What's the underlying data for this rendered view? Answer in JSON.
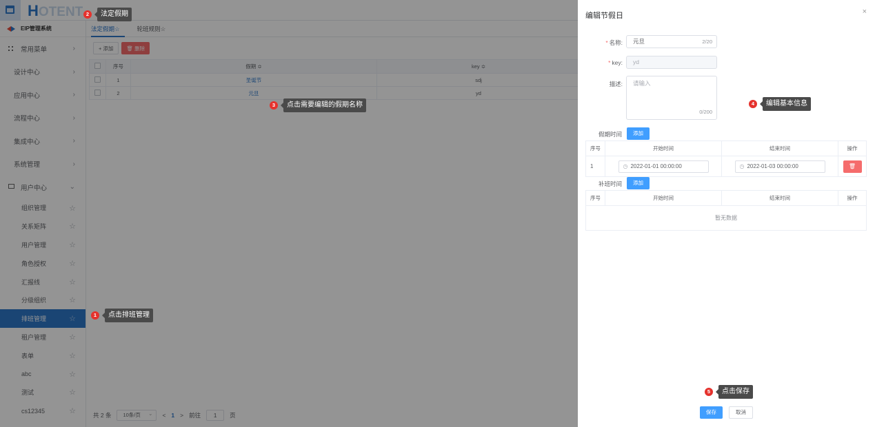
{
  "logo": {
    "first": "H",
    "rest": "OTENT"
  },
  "sidebar": {
    "system_title": "EIP管理系统",
    "favorites": "常用菜单",
    "groups": [
      "设计中心",
      "应用中心",
      "流程中心",
      "集成中心",
      "系统管理"
    ],
    "user_center": "用户中心",
    "sub_items": [
      "组织管理",
      "关系矩阵",
      "用户管理",
      "角色授权",
      "汇报线",
      "分级组织",
      "排班管理",
      "租户管理",
      "表单",
      "abc",
      "测试",
      "cs12345"
    ],
    "active_sub_item": "排班管理"
  },
  "main": {
    "tabs": [
      "法定假期☆",
      "轮班规则☆"
    ],
    "add_label": "+ 添加",
    "delete_label": "🗑 删除",
    "columns": [
      "序号",
      "假期 ≎",
      "key ≎"
    ],
    "rows": [
      {
        "index": "1",
        "name": "圣诞节",
        "key": "sdj"
      },
      {
        "index": "2",
        "name": "元旦",
        "key": "yd"
      }
    ],
    "pager": {
      "total": "共 2 条",
      "page_size": "10条/页",
      "prev": "<",
      "current": "1",
      "next": ">",
      "goto_prefix": "前往",
      "goto_value": "1",
      "goto_suffix": "页"
    }
  },
  "drawer": {
    "title": "编辑节假日",
    "close": "×",
    "name_label": "名称:",
    "name_value": "元旦",
    "name_counter": "2/20",
    "key_label": "key:",
    "key_value": "yd",
    "desc_label": "描述:",
    "desc_placeholder": "请输入",
    "desc_counter": "0/200",
    "holiday_label": "假期时间",
    "makeup_label": "补班时间",
    "add_label": "添加",
    "table_cols": [
      "序号",
      "开始时间",
      "结束时间",
      "操作"
    ],
    "holiday_rows": [
      {
        "index": "1",
        "start": "2022-01-01 00:00:00",
        "end": "2022-01-03 00:00:00",
        "action": "🗑"
      }
    ],
    "empty_text": "暂无数据",
    "save_label": "保存",
    "cancel_label": "取消"
  },
  "callouts": [
    {
      "num": "1",
      "text": "点击排班管理"
    },
    {
      "num": "2",
      "text": "法定假期"
    },
    {
      "num": "3",
      "text": "点击需要编辑的假期名称"
    },
    {
      "num": "4",
      "text": "编辑基本信息"
    },
    {
      "num": "5",
      "text": "点击保存"
    }
  ],
  "colors": {
    "primary": "#2d77c9",
    "danger": "#f56c6c",
    "button_blue": "#409eff",
    "badge_red": "#e5322d"
  }
}
